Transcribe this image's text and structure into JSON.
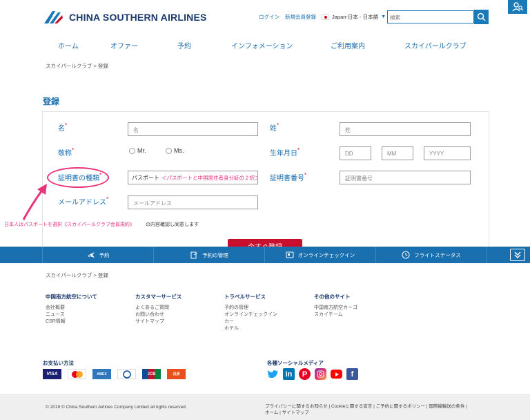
{
  "header": {
    "logo_text": "CHINA SOUTHERN AIRLINES",
    "login": "ログイン",
    "register": "新規会員登録",
    "language": "Japan-日本 - 日本語",
    "search_placeholder": "検索"
  },
  "nav": {
    "items": [
      {
        "label": "ホーム",
        "has_menu": false
      },
      {
        "label": "オファー",
        "has_menu": true
      },
      {
        "label": "予約",
        "has_menu": true
      },
      {
        "label": "インフォメーション",
        "has_menu": true
      },
      {
        "label": "ご利用案内",
        "has_menu": true
      },
      {
        "label": "スカイパールクラブ",
        "has_menu": false
      }
    ],
    "chevron": "⌄"
  },
  "breadcrumb": "スカイパールクラブ > 登録",
  "form": {
    "title": "登録",
    "first_name_label": "名",
    "first_name_placeholder": "名",
    "last_name_label": "姓",
    "last_name_placeholder": "姓",
    "title_label": "敬称",
    "title_options": [
      "Mr.",
      "Ms."
    ],
    "birthday_label": "生年月日",
    "dd_placeholder": "DD",
    "mm_placeholder": "MM",
    "yyyy_placeholder": "YYYY",
    "id_type_label": "証明書の種類",
    "id_type_value": "パスポート",
    "id_number_label": "証明書番号",
    "id_number_placeholder": "証明書番号",
    "email_label": "メールアドレス",
    "email_placeholder": "メールアドレス",
    "required_mark": "*",
    "submit_label": "今すぐ登録"
  },
  "annotations": {
    "inline_note": "＜パスポートと中国居住者身分証の２択＞",
    "bottom_note": "日本人はパスポートを選択",
    "terms_link": "《スカイパールクラブ会員規約》",
    "terms_rest": "の内容確認し同意します",
    "accent_color": "#e8337d"
  },
  "bottom_bar": {
    "items": [
      {
        "label": "予約",
        "icon": "plane-icon"
      },
      {
        "label": "予約の管理",
        "icon": "manage-booking-icon"
      },
      {
        "label": "オンラインチェックイン",
        "icon": "ticket-icon"
      },
      {
        "label": "フライトステータス",
        "icon": "clock-icon"
      }
    ],
    "color": "#1a6fae"
  },
  "footer": {
    "breadcrumb": "スカイパールクラブ > 登録",
    "columns": [
      {
        "title": "中国南方航空について",
        "links": [
          "会社概要",
          "ニュース",
          "CSR情報"
        ]
      },
      {
        "title": "カスタマーサービス",
        "links": [
          "よくあるご質問",
          "お問い合わせ",
          "サイトマップ"
        ]
      },
      {
        "title": "トラベルサービス",
        "links": [
          "予約の管理",
          "オンラインチェックイン",
          "カー",
          "ホテル"
        ]
      },
      {
        "title": "その他のサイト",
        "links": [
          "中国南方航空カーゴ",
          "スカイチーム"
        ]
      }
    ],
    "payment_title": "お支払い方法",
    "payment_methods": [
      "VISA",
      "Mastercard",
      "American Express",
      "Diners Club",
      "JCB",
      "コンビニ決済"
    ],
    "social_title": "各種ソーシャルメディア",
    "social": [
      "twitter-icon",
      "linkedin-icon",
      "pinterest-icon",
      "instagram-icon",
      "youtube-icon",
      "facebook-icon"
    ],
    "copyright": "© 2019 © China Southern Airlines Company Limited all rights reserved.",
    "policy_line1": "プライバシーに関するお知らせ | Cookieに関する宣言 | ご予約に関するポリシー | 国際線輸送の条件 |",
    "policy_line2": "ホーム | サイトマップ"
  }
}
